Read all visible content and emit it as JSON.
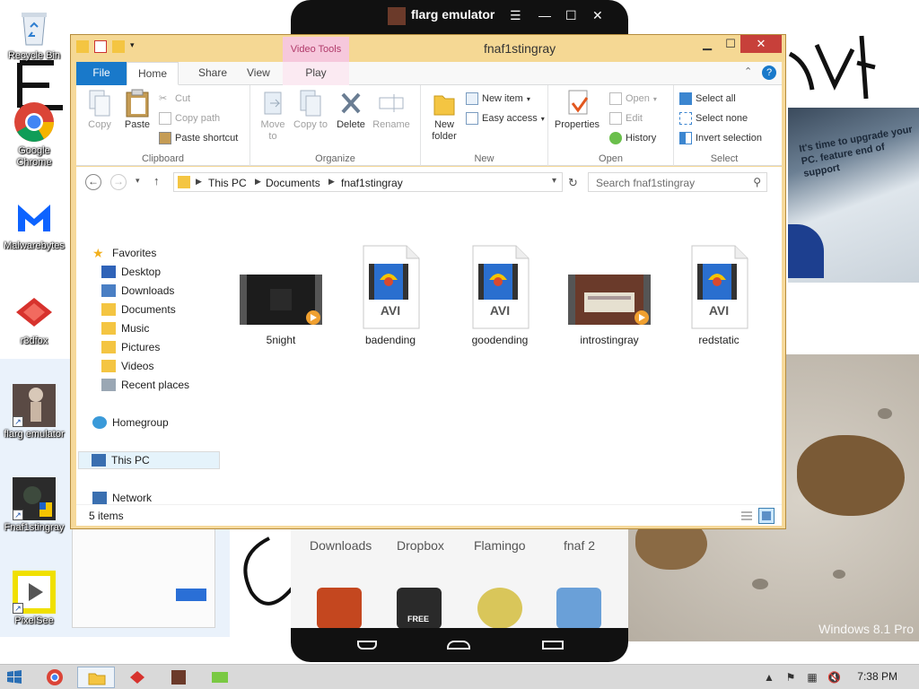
{
  "desktop": {
    "icons": [
      {
        "label": "Recycle Bin"
      },
      {
        "label": "Google Chrome"
      },
      {
        "label": "Malwarebytes"
      },
      {
        "label": "r3dfox"
      },
      {
        "label": "flarg emulator"
      },
      {
        "label": "Fnaf1stingray"
      },
      {
        "label": "PixelSee"
      }
    ],
    "watermark": "Windows 8.1 Pro",
    "photo_text": "It's time to upgrade your PC. feature end of support"
  },
  "emulator": {
    "title": "flarg emulator",
    "apps": [
      "Downloads",
      "Dropbox",
      "Flamingo",
      "fnaf 2"
    ],
    "app_icon_badge": "FREE"
  },
  "explorer": {
    "title": "fnaf1stingray",
    "contextual_tab_group": "Video Tools",
    "tabs": {
      "file": "File",
      "home": "Home",
      "share": "Share",
      "view": "View",
      "play": "Play"
    },
    "ribbon": {
      "clipboard": {
        "label": "Clipboard",
        "copy": "Copy",
        "paste": "Paste",
        "cut": "Cut",
        "copy_path": "Copy path",
        "paste_shortcut": "Paste shortcut"
      },
      "organize": {
        "label": "Organize",
        "move_to": "Move to",
        "copy_to": "Copy to",
        "delete": "Delete",
        "rename": "Rename"
      },
      "new": {
        "label": "New",
        "new_folder": "New folder",
        "new_item": "New item",
        "easy_access": "Easy access"
      },
      "open": {
        "label": "Open",
        "properties": "Properties",
        "open": "Open",
        "edit": "Edit",
        "history": "History"
      },
      "select": {
        "label": "Select",
        "select_all": "Select all",
        "select_none": "Select none",
        "invert": "Invert selection"
      }
    },
    "address": {
      "crumbs": [
        "This PC",
        "Documents",
        "fnaf1stingray"
      ],
      "search_placeholder": "Search fnaf1stingray"
    },
    "nav": {
      "favorites": "Favorites",
      "favorites_items": [
        "Desktop",
        "Downloads",
        "Documents",
        "Music",
        "Pictures",
        "Videos",
        "Recent places"
      ],
      "homegroup": "Homegroup",
      "this_pc": "This PC",
      "network": "Network"
    },
    "files": [
      {
        "name": "5night",
        "type": "video-thumb-dark"
      },
      {
        "name": "badending",
        "type": "avi"
      },
      {
        "name": "goodending",
        "type": "avi"
      },
      {
        "name": "introstingray",
        "type": "video-thumb-scene"
      },
      {
        "name": "redstatic",
        "type": "avi"
      }
    ],
    "avi_label": "AVI",
    "status": "5 items"
  },
  "taskbar": {
    "clock": "7:38 PM"
  },
  "colors": {
    "explorer_frame": "#f6d99a",
    "file_tab": "#1979ca",
    "video_tools": "#f6c8dc",
    "close_button": "#c7403a",
    "taskbar": "#d9d9d9"
  }
}
